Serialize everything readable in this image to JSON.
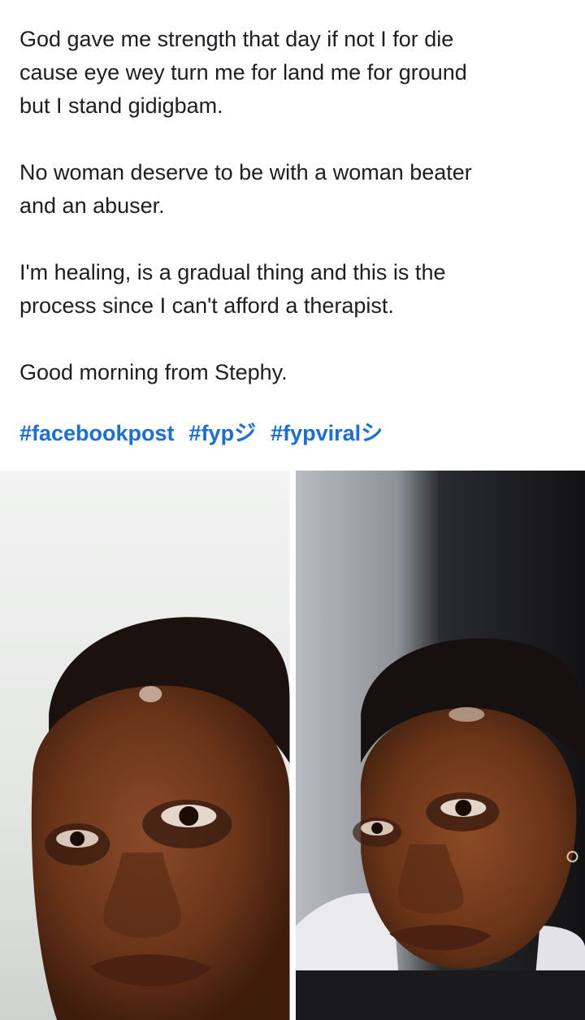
{
  "post": {
    "paragraphs": [
      "God gave me strength that day if not I for die\ncause eye wey turn me for land me for ground\nbut I stand gidigbam.",
      "No woman deserve to be with a woman beater\nand an abuser.",
      "I'm healing, is a gradual thing and this is the\nprocess since I can't afford a therapist.",
      "Good morning from Stephy."
    ],
    "hashtags": [
      "#facebookpost",
      "#fypジ",
      "#fypviralシ"
    ]
  },
  "colors": {
    "text": "#1c1e21",
    "hashtag": "#1a6fd6",
    "background": "#ffffff"
  },
  "photos": [
    {
      "name": "photo-left"
    },
    {
      "name": "photo-right"
    }
  ]
}
